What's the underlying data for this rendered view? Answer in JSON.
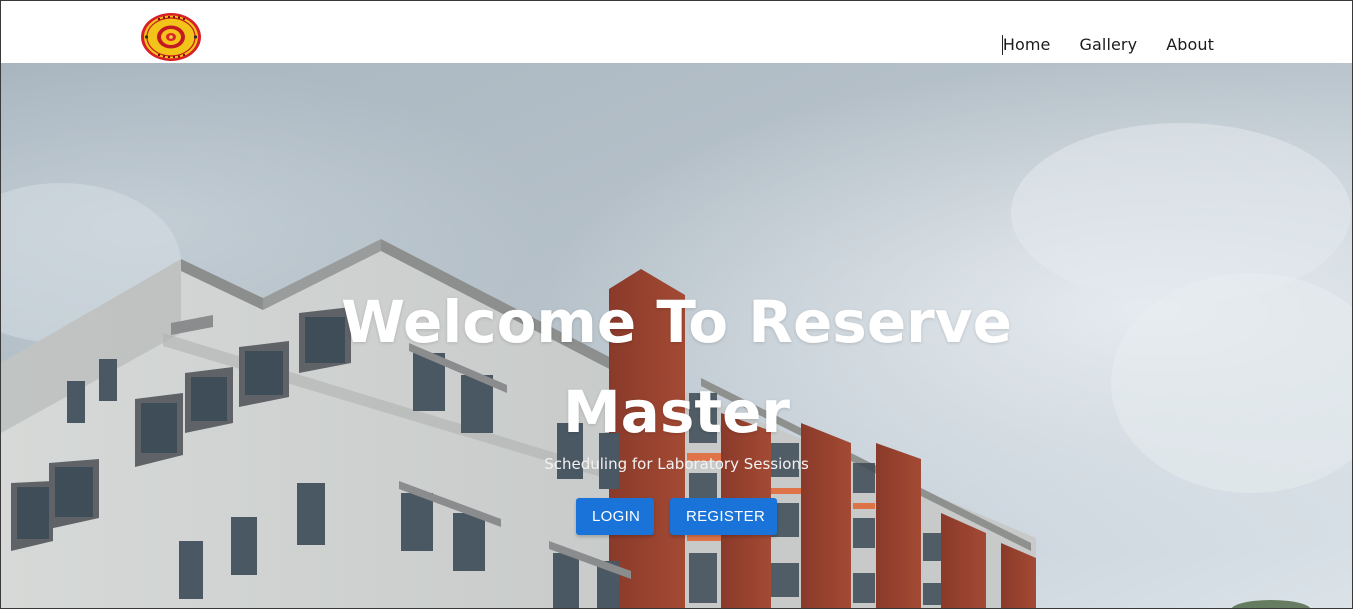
{
  "header": {
    "logo_icon": "university-seal-logo",
    "nav": [
      {
        "label": "Home",
        "active": true
      },
      {
        "label": "Gallery",
        "active": false
      },
      {
        "label": "About",
        "active": false
      }
    ]
  },
  "hero": {
    "title": "Welcome To Reserve Master",
    "subtitle": "Scheduling for Laboratory Sessions",
    "buttons": {
      "login_label": "LOGIN",
      "register_label": "REGISTER"
    },
    "background": "building-photo"
  },
  "colors": {
    "accent": "#1a73d9",
    "nav_text": "#1b1b1b",
    "hero_text": "#ffffff"
  }
}
